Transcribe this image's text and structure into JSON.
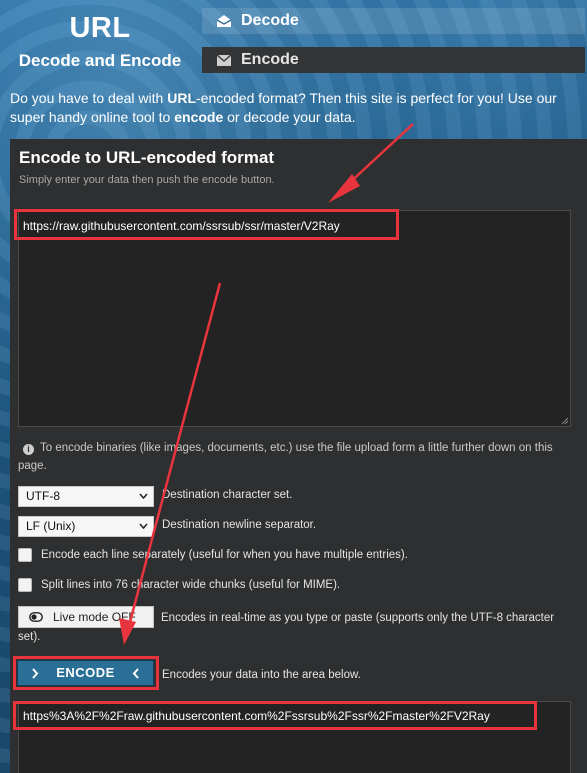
{
  "header": {
    "logo_title": "URL",
    "logo_subtitle": "Decode and Encode",
    "tabs": [
      {
        "label": "Decode",
        "icon": "envelope-open-icon"
      },
      {
        "label": "Encode",
        "icon": "envelope-icon"
      }
    ]
  },
  "intro": {
    "part1": "Do you have to deal with ",
    "bold1": "URL",
    "part2": "-encoded format? Then this site is perfect for you! Use our super handy online tool to ",
    "bold2": "encode",
    "part3": " or decode your data."
  },
  "panel": {
    "title": "Encode to URL-encoded format",
    "subtitle": "Simply enter your data then push the encode button.",
    "input_value": "https://raw.githubusercontent.com/ssrsub/ssr/master/V2Ray",
    "info_text": "To encode binaries (like images, documents, etc.) use the file upload form a little further down on this page.",
    "charset": {
      "value": "UTF-8",
      "label": "Destination character set."
    },
    "newline": {
      "value": "LF (Unix)",
      "label": "Destination newline separator."
    },
    "encode_each_line": {
      "checked": false,
      "label": "Encode each line separately (useful for when you have multiple entries)."
    },
    "split_lines": {
      "checked": false,
      "label": "Split lines into 76 character wide chunks (useful for MIME)."
    },
    "live_mode": {
      "label": "Live mode OFF",
      "description": "Encodes in real-time as you type or paste (supports only the UTF-8 character set)."
    },
    "encode_button": {
      "label": "ENCODE",
      "description": "Encodes your data into the area below."
    },
    "output_value": "https%3A%2F%2Fraw.githubusercontent.com%2Fssrsub%2Fssr%2Fmaster%2FV2Ray"
  },
  "colors": {
    "highlight": "#e8343c",
    "panel_bg": "#2e2f30",
    "button_bg": "#2a6f96"
  }
}
